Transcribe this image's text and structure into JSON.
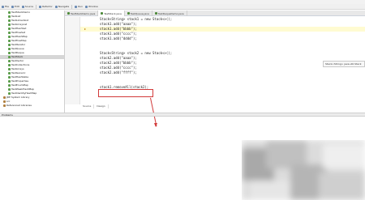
{
  "toolbar": {
    "buttons": [
      {
        "label": "File",
        "icon": "file-icon"
      },
      {
        "label": "Edit",
        "icon": "edit-icon"
      },
      {
        "label": "Source",
        "icon": "source-icon"
      },
      {
        "label": "Refactor",
        "icon": "refactor-icon"
      },
      {
        "label": "Navigate",
        "icon": "navigate-icon"
      },
      {
        "label": "Run",
        "icon": "run-icon"
      },
      {
        "label": "Window",
        "icon": "window-icon"
      }
    ]
  },
  "tree": {
    "items": [
      "TestStackDemo",
      "TestList",
      "TestLinkedList",
      "TestArrayList",
      "TestHashSet",
      "TestTreeSet",
      "TestHashMap",
      "TestTreeMap",
      "TestIterator",
      "TestQueue",
      "TestDeque",
      "TestStack",
      "TestVector",
      "TestCollections",
      "TestArrays",
      "TestGeneric",
      "TestHashtable",
      "TestProperties",
      "TestEnumMap",
      "TestWeakHashMap",
      "TestIdentityHashMap",
      "JRE System Library",
      "src",
      "Referenced Libraries"
    ],
    "selected_index": 11
  },
  "tabs": [
    {
      "label": "TestStackDemo.java",
      "active": false
    },
    {
      "label": "TestStack.java",
      "active": true
    },
    {
      "label": "TestQueue.java",
      "active": false
    },
    {
      "label": "TestDequeDemo.java",
      "active": false
    }
  ],
  "editor": {
    "lines": [
      {
        "text": "Stack<String> stack1 = new Stack<>();",
        "kind": "decl"
      },
      {
        "text": "stack1.add(\"aaaa\");",
        "kind": "call"
      },
      {
        "text": "stack1.add(\"bbbb\");",
        "kind": "call"
      },
      {
        "text": "stack1.add(\"cccc\");",
        "kind": "call"
      },
      {
        "text": "stack1.add(\"dddd\");",
        "kind": "call"
      },
      {
        "text": "",
        "kind": "blank"
      },
      {
        "text": "",
        "kind": "blank"
      },
      {
        "text": "Stack<String> stack2 = new Stack<>();",
        "kind": "decl"
      },
      {
        "text": "stack2.add(\"aaaa\");",
        "kind": "call"
      },
      {
        "text": "stack2.add(\"bbbb\");",
        "kind": "call"
      },
      {
        "text": "stack2.add(\"cccc\");",
        "kind": "call"
      },
      {
        "text": "stack2.add(\"ffff\");",
        "kind": "call"
      },
      {
        "text": "",
        "kind": "blank"
      },
      {
        "text": "",
        "kind": "blank"
      },
      {
        "text": "stack1.removeAll(stack2);",
        "kind": "call"
      }
    ],
    "highlighted_line": 2
  },
  "tooltip": {
    "text": "Stack<String> java.util.Stack"
  },
  "bottom_tabs": [
    "Source",
    "Design"
  ],
  "console": {
    "label": "Problems"
  },
  "colors": {
    "annotation": "#d23a3a",
    "keyword": "#7f0055",
    "string": "#2a00ff",
    "highlight": "#fffbd1"
  }
}
